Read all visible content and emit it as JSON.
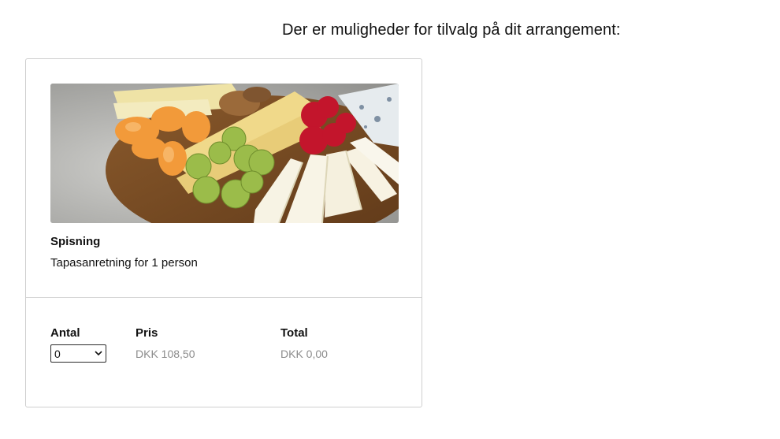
{
  "heading": "Der er muligheder for tilvalg på dit arrangement:",
  "addon": {
    "image_subject": "cheese-platter-photo",
    "category": "Spisning",
    "title": "Tapasanretning for 1 person",
    "labels": {
      "quantity": "Antal",
      "price": "Pris",
      "total": "Total"
    },
    "quantity_selected": "0",
    "price": "DKK 108,50",
    "total": "DKK 0,00"
  },
  "colors": {
    "text": "#111111",
    "muted": "#8c8c8c",
    "border": "#cfcfcf"
  }
}
